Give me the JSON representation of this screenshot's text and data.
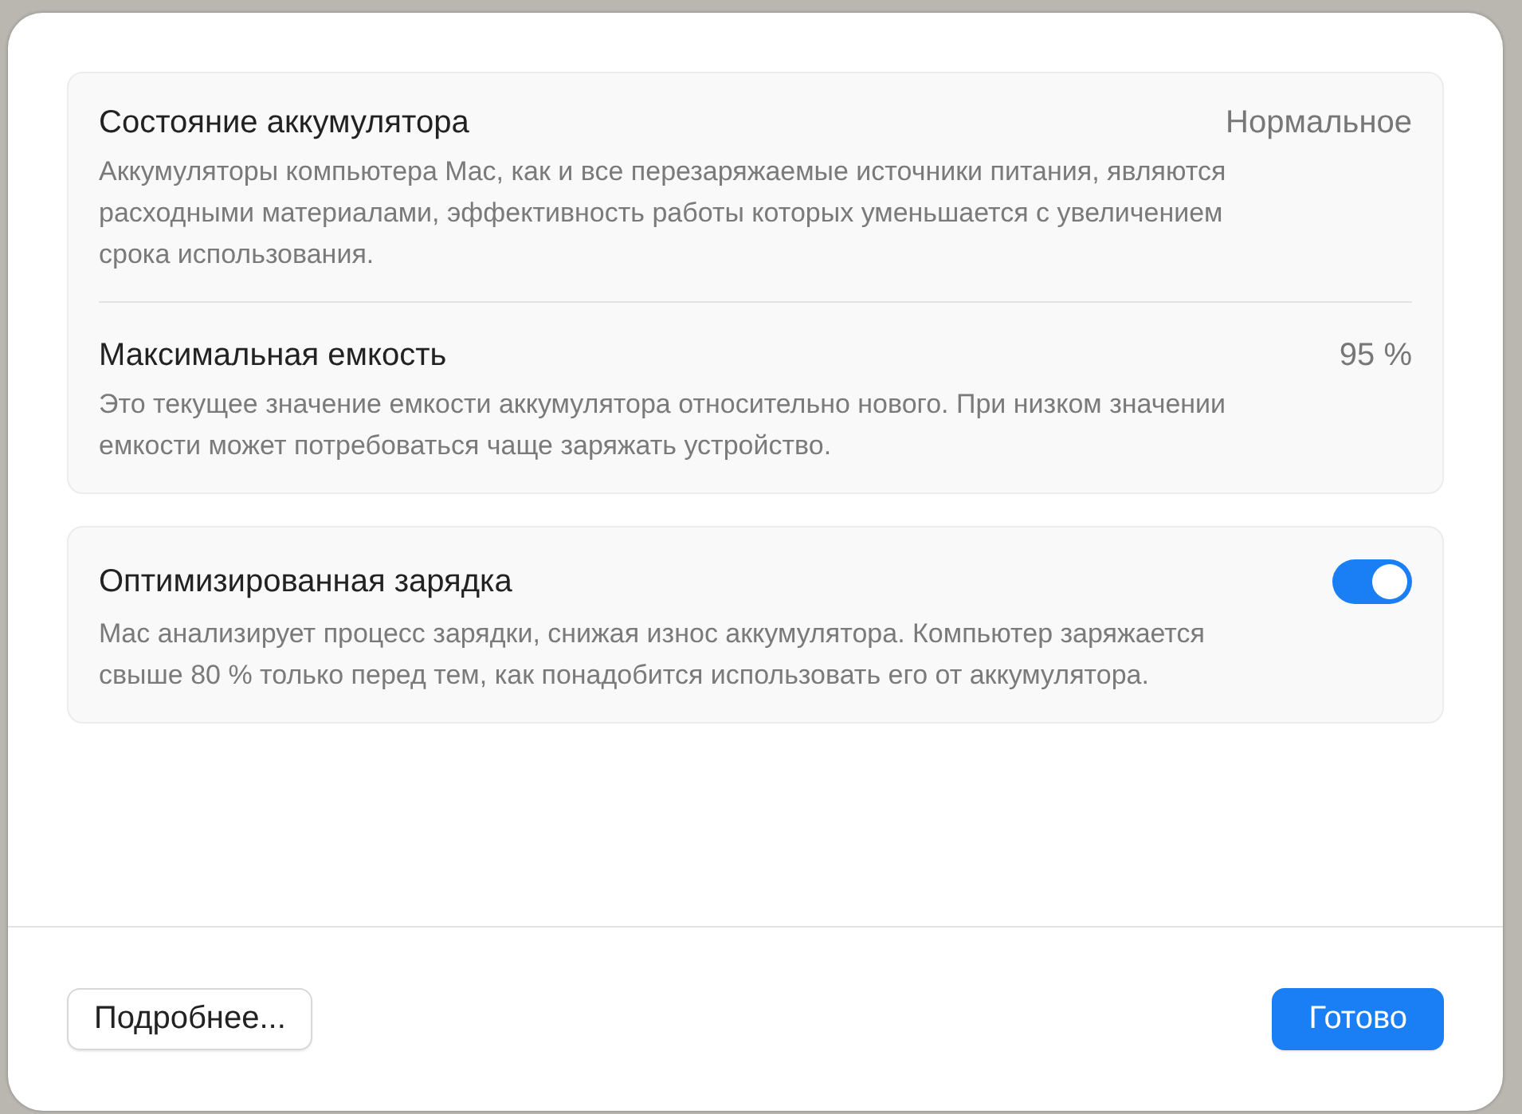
{
  "groups": [
    {
      "rows": [
        {
          "kind": "value",
          "title": "Состояние аккумулятора",
          "value": "Нормальное",
          "description": "Аккумуляторы компьютера Mac, как и все перезаряжаемые источники питания, являются расходными материалами, эффективность работы которых уменьшается с увеличением срока использования."
        },
        {
          "kind": "value",
          "title": "Максимальная емкость",
          "value": "95 %",
          "description": "Это текущее значение емкости аккумулятора относительно нового. При низком значении емкости может потребоваться чаще заряжать устройство."
        }
      ]
    },
    {
      "rows": [
        {
          "kind": "toggle",
          "title": "Оптимизированная зарядка",
          "on": true,
          "description": "Mac анализирует процесс зарядки, снижая износ аккумулятора. Компьютер заряжается свыше 80 % только перед тем, как понадобится использовать его от аккумулятора."
        }
      ]
    }
  ],
  "buttons": [
    {
      "label": "Подробнее...",
      "primary": false
    },
    {
      "label": "Готово",
      "primary": true
    }
  ]
}
